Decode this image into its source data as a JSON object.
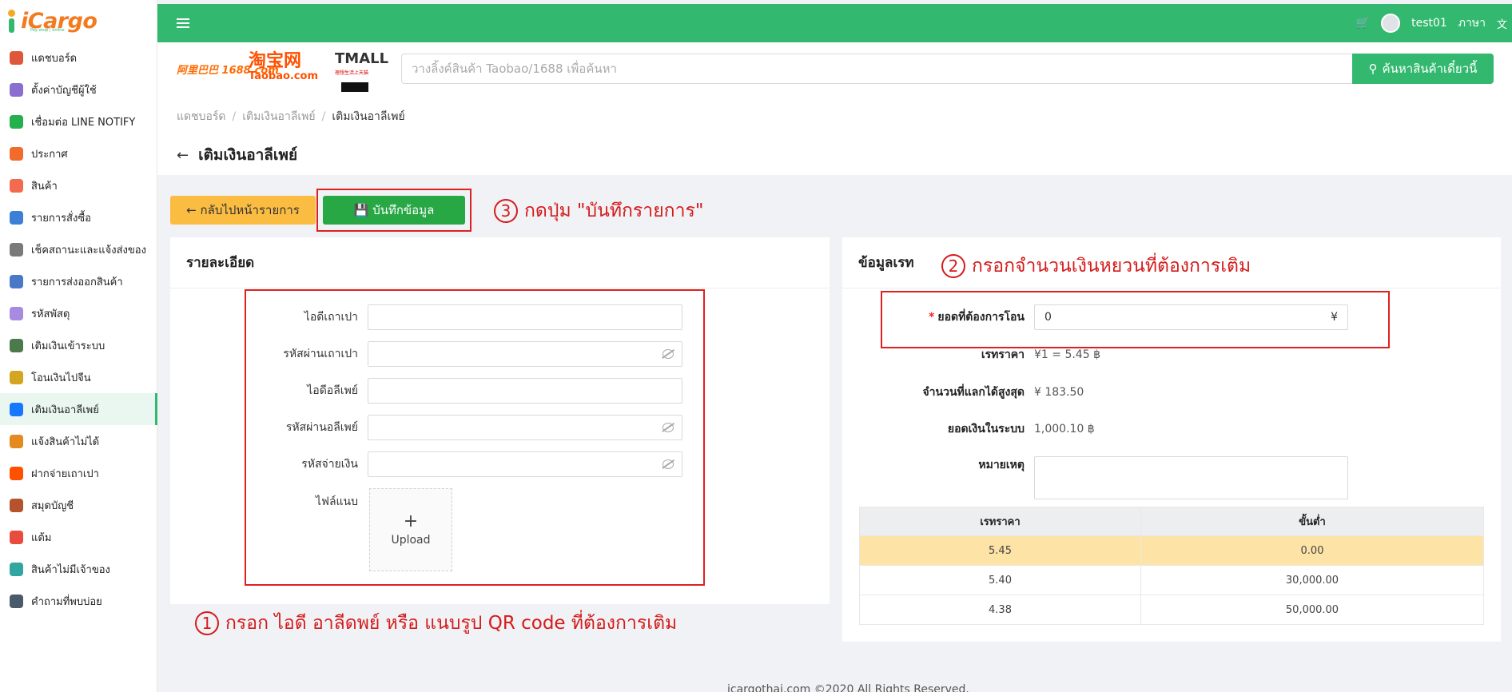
{
  "app": {
    "logo": "iCargo",
    "logo_sub": "Pay shop | online"
  },
  "sidebar": {
    "items": [
      {
        "label": "แดชบอร์ด",
        "icon": "chart-icon",
        "color": "#e0563b"
      },
      {
        "label": "ตั้งค่าบัญชีผู้ใช้",
        "icon": "user-settings-icon",
        "color": "#8a6fd1"
      },
      {
        "label": "เชื่อมต่อ LINE NOTIFY",
        "icon": "line-icon",
        "color": "#22b14c"
      },
      {
        "label": "ประกาศ",
        "icon": "megaphone-icon",
        "color": "#f26b2a"
      },
      {
        "label": "สินค้า",
        "icon": "bag-icon",
        "color": "#f46a4e"
      },
      {
        "label": "รายการสั่งซื้อ",
        "icon": "truck-icon",
        "color": "#3c7fd6"
      },
      {
        "label": "เช็คสถานะและแจ้งส่งของ",
        "icon": "checklist-icon",
        "color": "#7a7a7a"
      },
      {
        "label": "รายการส่งออกสินค้า",
        "icon": "export-icon",
        "color": "#4a78c8"
      },
      {
        "label": "รหัสพัสดุ",
        "icon": "parcel-icon",
        "color": "#a78be0"
      },
      {
        "label": "เติมเงินเข้าระบบ",
        "icon": "wallet-icon",
        "color": "#4b7b4b"
      },
      {
        "label": "โอนเงินไปจีน",
        "icon": "coin-icon",
        "color": "#d4a520"
      },
      {
        "label": "เติมเงินอาลีเพย์",
        "icon": "alipay-icon",
        "color": "#1677ff"
      },
      {
        "label": "แจ้งสินค้าไม่ได้",
        "icon": "alert-box-icon",
        "color": "#e58a1f"
      },
      {
        "label": "ฝากจ่ายเถาเปา",
        "icon": "taobao-icon",
        "color": "#ff5000"
      },
      {
        "label": "สมุดบัญชี",
        "icon": "book-icon",
        "color": "#b5542c"
      },
      {
        "label": "แต้ม",
        "icon": "points-icon",
        "color": "#e84c3d"
      },
      {
        "label": "สินค้าไม่มีเจ้าของ",
        "icon": "unknown-box-icon",
        "color": "#2fa7a0"
      },
      {
        "label": "คำถามที่พบบ่อย",
        "icon": "faq-icon",
        "color": "#4a5a6a"
      }
    ],
    "active_index": 11
  },
  "topbar": {
    "user": "test01",
    "language": "ภาษา",
    "accent": "#33b96f"
  },
  "search": {
    "brand_1688": "阿里巴巴 1688.com",
    "brand_taobao": "淘宝网",
    "brand_taobao_sub": "Taobao.com",
    "brand_tmall": "TMALL",
    "brand_tmall_sub": "理想生活上天猫",
    "placeholder": "วางลิ้งค์สินค้า Taobao/1688 เพื่อค้นหา",
    "button": "ค้นหาสินค้าเดี๋ยวนี้"
  },
  "breadcrumb": [
    "แดชบอร์ด",
    "เติมเงินอาลีเพย์",
    "เติมเงินอาลีเพย์"
  ],
  "page_title": "เติมเงินอาลีเพย์",
  "actions": {
    "back": "กลับไปหน้ารายการ",
    "save": "บันทึกข้อมูล"
  },
  "annotations": {
    "step1_num": "1",
    "step1": "กรอก ไอดี อาลีดพย์ หรือ แนบรูป QR code ที่ต้องการเติม",
    "step2_num": "2",
    "step2": "กรอกจำนวนเงินหยวนที่ต้องการเติม",
    "step3_num": "3",
    "step3": "กดปุ่ม \"บันทึกรายการ\""
  },
  "details": {
    "title": "รายละเอียด",
    "taobao_id": "ไอดีเถาเปา",
    "taobao_password": "รหัสผ่านเถาเปา",
    "alipay_id": "ไอดีอลีเพย์",
    "alipay_password": "รหัสผ่านอลีเพย์",
    "payment_code": "รหัสจ่ายเงิน",
    "attachment": "ไฟล์แนบ",
    "upload": "Upload"
  },
  "rate": {
    "title": "ข้อมูลเรท",
    "amount_label": "ยอดที่ต้องการโอน",
    "amount_value": "0",
    "currency": "¥",
    "rate_label": "เรทราคา",
    "rate_value": "¥1 = 5.45 ฿",
    "max_label": "จำนวนที่แลกได้สูงสุด",
    "max_value": "¥ 183.50",
    "balance_label": "ยอดเงินในระบบ",
    "balance_value": "1,000.10 ฿",
    "remark_label": "หมายเหตุ",
    "table": {
      "headers": [
        "เรทราคา",
        "ขั้นต่ำ"
      ],
      "rows": [
        [
          "5.45",
          "0.00"
        ],
        [
          "5.40",
          "30,000.00"
        ],
        [
          "4.38",
          "50,000.00"
        ]
      ],
      "highlight_row": 0
    }
  },
  "footer": "icargothai.com ©2020 All Rights Reserved."
}
